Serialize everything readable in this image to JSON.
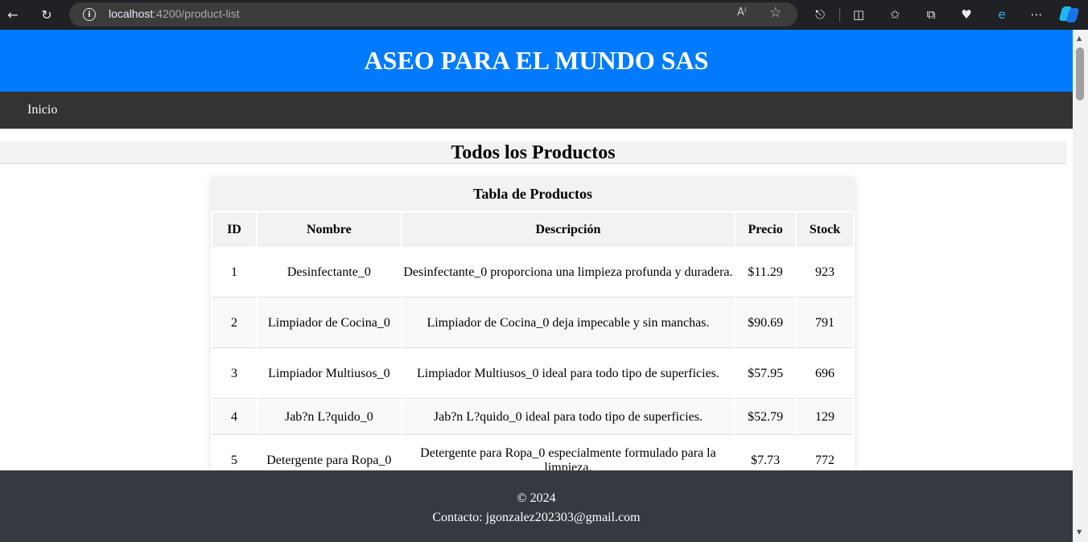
{
  "browser": {
    "url_host": "localhost",
    "url_path": ":4200/product-list",
    "icons": [
      "back-arrow-icon",
      "reload-icon",
      "site-info-icon",
      "read-aloud-icon",
      "favorite-star-icon",
      "extensions-icon",
      "split-screen-icon",
      "favorites-icon",
      "collections-icon",
      "browser-essentials-icon",
      "edge-icon",
      "more-menu-icon",
      "copilot-icon"
    ]
  },
  "header": {
    "title": "ASEO PARA EL MUNDO SAS",
    "bg_color": "#007bff"
  },
  "nav": {
    "items": [
      {
        "label": "Inicio"
      }
    ],
    "bg_color": "#333333"
  },
  "main": {
    "section_title": "Todos los Productos",
    "table": {
      "caption": "Tabla de Productos",
      "columns": [
        "ID",
        "Nombre",
        "Descripción",
        "Precio",
        "Stock"
      ],
      "rows": [
        {
          "id": "1",
          "name": "Desinfectante_0",
          "description": "Desinfectante_0 proporciona una limpieza profunda y duradera.",
          "price": "$11.29",
          "stock": "923"
        },
        {
          "id": "2",
          "name": "Limpiador de Cocina_0",
          "description": "Limpiador de Cocina_0 deja impecable y sin manchas.",
          "price": "$90.69",
          "stock": "791"
        },
        {
          "id": "3",
          "name": "Limpiador Multiusos_0",
          "description": "Limpiador Multiusos_0 ideal para todo tipo de superficies.",
          "price": "$57.95",
          "stock": "696"
        },
        {
          "id": "4",
          "name": "Jab?n L?quido_0",
          "description": "Jab?n L?quido_0 ideal para todo tipo de superficies.",
          "price": "$52.79",
          "stock": "129"
        },
        {
          "id": "5",
          "name": "Detergente para Ropa_0",
          "description": "Detergente para Ropa_0 especialmente formulado para la limpieza.",
          "price": "$7.73",
          "stock": "772"
        }
      ]
    }
  },
  "footer": {
    "copyright": "© 2024",
    "contact": "Contacto: jgonzalez202303@gmail.com",
    "bg_color": "#343a40"
  }
}
